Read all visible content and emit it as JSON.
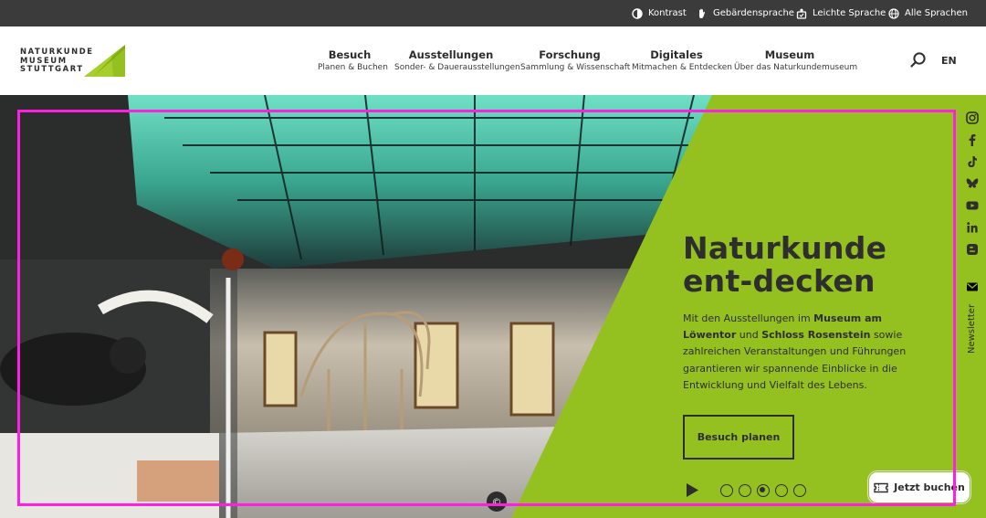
{
  "utility_bar": {
    "contrast": "Kontrast",
    "sign_language": "Gebärdensprache",
    "easy_language": "Leichte Sprache",
    "all_languages": "Alle Sprachen"
  },
  "logo": {
    "line1": "NATURKUNDE",
    "line2": "MUSEUM",
    "line3": "STUTTGART"
  },
  "nav": [
    {
      "title": "Besuch",
      "sub": "Planen & Buchen"
    },
    {
      "title": "Ausstellungen",
      "sub": "Sonder- & Dauerausstellungen"
    },
    {
      "title": "Forschung",
      "sub": "Sammlung & Wissenschaft"
    },
    {
      "title": "Digitales",
      "sub": "Mitmachen & Entdecken"
    },
    {
      "title": "Museum",
      "sub": "Über das Naturkundemuseum"
    }
  ],
  "language_switch": "EN",
  "hero": {
    "title": "Naturkunde ent-decken",
    "text_1": "Mit den Ausstellungen im ",
    "text_bold_1": "Museum am Löwentor",
    "text_2": " und ",
    "text_bold_2": "Schloss Rosenstein",
    "text_3": " sowie zahlreichen Veranstaltungen und Führungen garantieren wir spannende Einblicke in die Entwicklung und Vielfalt des Lebens.",
    "cta_label": "Besuch planen",
    "slides_total": 5,
    "active_slide": 3,
    "copyright_symbol": "©"
  },
  "social": [
    "instagram-icon",
    "facebook-icon",
    "tiktok-icon",
    "bluesky-icon",
    "youtube-icon",
    "linkedin-icon",
    "blogger-icon"
  ],
  "newsletter_label": "Newsletter",
  "book_button": "Jetzt buchen",
  "colors": {
    "brand_green": "#94c11f",
    "dark": "#2e2e2e",
    "utility_bar": "#3b3b3b",
    "focus_frame": "#ff1fe0"
  }
}
